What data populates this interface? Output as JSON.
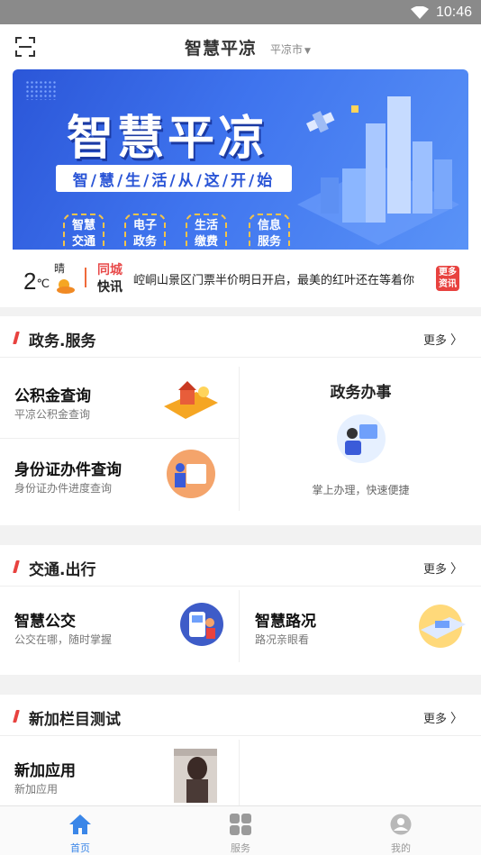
{
  "status": {
    "time": "10:46"
  },
  "header": {
    "title": "智慧平凉",
    "city": "平凉市"
  },
  "banner": {
    "big_title": "智慧平凉",
    "slogan": "智/慧/生/活/从/这/开/始",
    "tags": [
      "智慧交通",
      "电子政务",
      "生活缴费",
      "信息服务"
    ]
  },
  "news": {
    "temperature": "2",
    "unit": "℃",
    "weather": "晴",
    "label_line1": "同城",
    "label_line2": "快讯",
    "headline": "崆峒山景区门票半价明日开启，最美的红叶还在等着你",
    "more_label": "更多资讯"
  },
  "sections": {
    "gov": {
      "title": "政务.服务",
      "more": "更多",
      "items": [
        {
          "title": "公积金查询",
          "sub": "平凉公积金查询"
        },
        {
          "title": "身份证办件查询",
          "sub": "身份证办件进度查询"
        }
      ],
      "feature": {
        "title": "政务办事",
        "sub": "掌上办理，快速便捷"
      }
    },
    "traffic": {
      "title": "交通.出行",
      "more": "更多",
      "items": [
        {
          "title": "智慧公交",
          "sub": "公交在哪，随时掌握"
        },
        {
          "title": "智慧路况",
          "sub": "路况亲眼看"
        }
      ]
    },
    "newcol": {
      "title": "新加栏目测试",
      "more": "更多",
      "items": [
        {
          "title": "新加应用",
          "sub": "新加应用"
        }
      ]
    }
  },
  "tabbar": {
    "tabs": [
      "首页",
      "服务",
      "我的"
    ],
    "active": 0
  },
  "colors": {
    "accent": "#3a86e8",
    "red": "#e8423f",
    "banner": "#3f74ee"
  }
}
